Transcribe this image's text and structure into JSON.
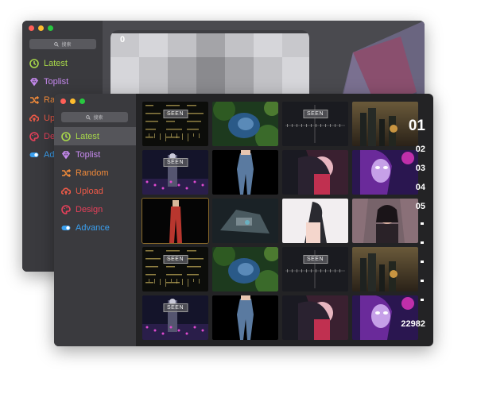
{
  "back_window": {
    "search_placeholder": "搜索",
    "counter": "0",
    "nav": [
      {
        "label": "Latest",
        "color": "#a8d84a",
        "icon": "clock-icon"
      },
      {
        "label": "Toplist",
        "color": "#c78af0",
        "icon": "diamond-icon"
      },
      {
        "label": "Random",
        "color": "#f08a3a",
        "icon": "shuffle-icon"
      },
      {
        "label": "Upload",
        "color": "#ee5a48",
        "icon": "cloud-upload-icon"
      },
      {
        "label": "Design",
        "color": "#e8405a",
        "icon": "palette-icon"
      },
      {
        "label": "Advance",
        "color": "#3aa0f0",
        "icon": "toggle-icon"
      }
    ]
  },
  "front_window": {
    "search_placeholder": "搜索",
    "active_index": 0,
    "nav": [
      {
        "label": "Latest",
        "color": "#a8d84a",
        "icon": "clock-icon"
      },
      {
        "label": "Toplist",
        "color": "#c78af0",
        "icon": "diamond-icon"
      },
      {
        "label": "Random",
        "color": "#f08a3a",
        "icon": "shuffle-icon"
      },
      {
        "label": "Upload",
        "color": "#ee5a48",
        "icon": "cloud-upload-icon"
      },
      {
        "label": "Design",
        "color": "#e8405a",
        "icon": "palette-icon"
      },
      {
        "label": "Advance",
        "color": "#3aa0f0",
        "icon": "toggle-icon"
      }
    ],
    "seen_label": "SEEN",
    "page_markers": [
      "01",
      "02",
      "03",
      "04",
      "05"
    ],
    "total": "22982"
  }
}
